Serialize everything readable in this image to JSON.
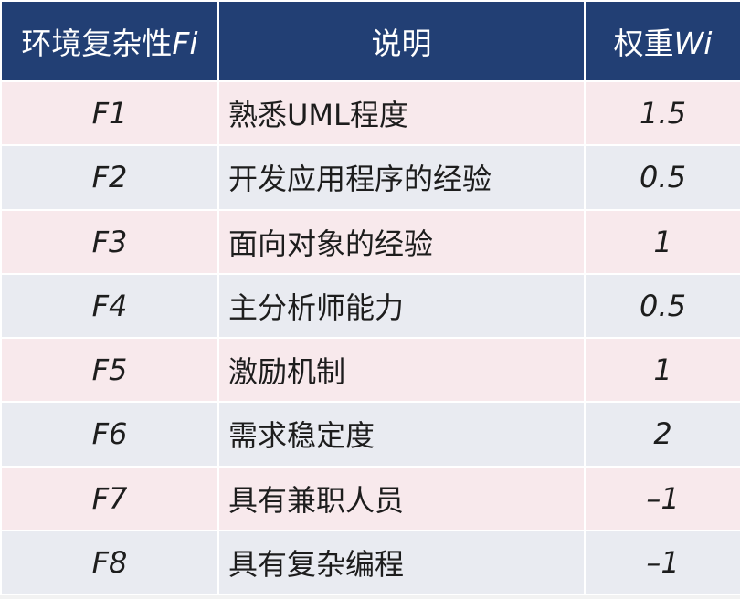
{
  "header": {
    "col_factor_prefix": "环境复杂性",
    "col_factor_suffix": "Fi",
    "col_desc": "说明",
    "col_weight_prefix": "权重",
    "col_weight_suffix": "Wi"
  },
  "rows": [
    {
      "id": "F1",
      "desc": "熟悉UML程度",
      "weight": "1.5"
    },
    {
      "id": "F2",
      "desc": "开发应用程序的经验",
      "weight": "0.5"
    },
    {
      "id": "F3",
      "desc": "面向对象的经验",
      "weight": "1"
    },
    {
      "id": "F4",
      "desc": "主分析师能力",
      "weight": "0.5"
    },
    {
      "id": "F5",
      "desc": "激励机制",
      "weight": "1"
    },
    {
      "id": "F6",
      "desc": "需求稳定度",
      "weight": "2"
    },
    {
      "id": "F7",
      "desc": "具有兼职人员",
      "weight": "–1"
    },
    {
      "id": "F8",
      "desc": "具有复杂编程",
      "weight": "–1"
    }
  ],
  "colors": {
    "header_bg": "#223f74",
    "row_pink": "#f8e9ec",
    "row_blue": "#e9ebf1"
  }
}
